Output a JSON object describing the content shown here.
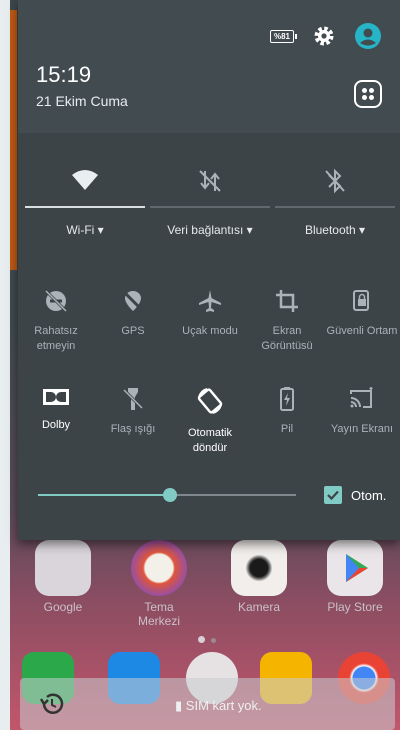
{
  "status": {
    "battery_label": "%81"
  },
  "clock": {
    "time": "15:19",
    "date": "21 Ekim Cuma"
  },
  "top_toggles": [
    {
      "label": "Wi-Fi",
      "icon": "wifi-icon",
      "active": true
    },
    {
      "label": "Veri bağlantısı",
      "icon": "mobile-data-off-icon",
      "active": false
    },
    {
      "label": "Bluetooth",
      "icon": "bluetooth-off-icon",
      "active": false
    }
  ],
  "tiles_row1": [
    {
      "label": "Rahatsız etmeyin",
      "icon": "do-not-disturb-off-icon"
    },
    {
      "label": "GPS",
      "icon": "gps-off-icon"
    },
    {
      "label": "Uçak modu",
      "icon": "airplane-icon"
    },
    {
      "label": "Ekran Görüntüsü",
      "icon": "screenshot-crop-icon"
    },
    {
      "label": "Güvenli Ortam",
      "icon": "secure-lock-icon"
    }
  ],
  "tiles_row2": [
    {
      "label": "Dolby",
      "icon": "dolby-icon",
      "active": true
    },
    {
      "label": "Flaş ışığı",
      "icon": "flashlight-off-icon",
      "active": false
    },
    {
      "label": "Otomatik döndür",
      "icon": "auto-rotate-icon",
      "active": true
    },
    {
      "label": "Pil",
      "icon": "battery-saver-icon",
      "active": false
    },
    {
      "label": "Yayın Ekranı",
      "icon": "cast-icon",
      "active": false
    }
  ],
  "brightness": {
    "level": 0.51,
    "auto_label": "Otom.",
    "auto_checked": true
  },
  "home": {
    "apps": [
      "Google",
      "Tema Merkezi",
      "Kamera",
      "Play Store"
    ],
    "sim_text": "SIM kart yok."
  },
  "colors": {
    "accent": "#80cbc4",
    "shade": "#3c4448"
  }
}
